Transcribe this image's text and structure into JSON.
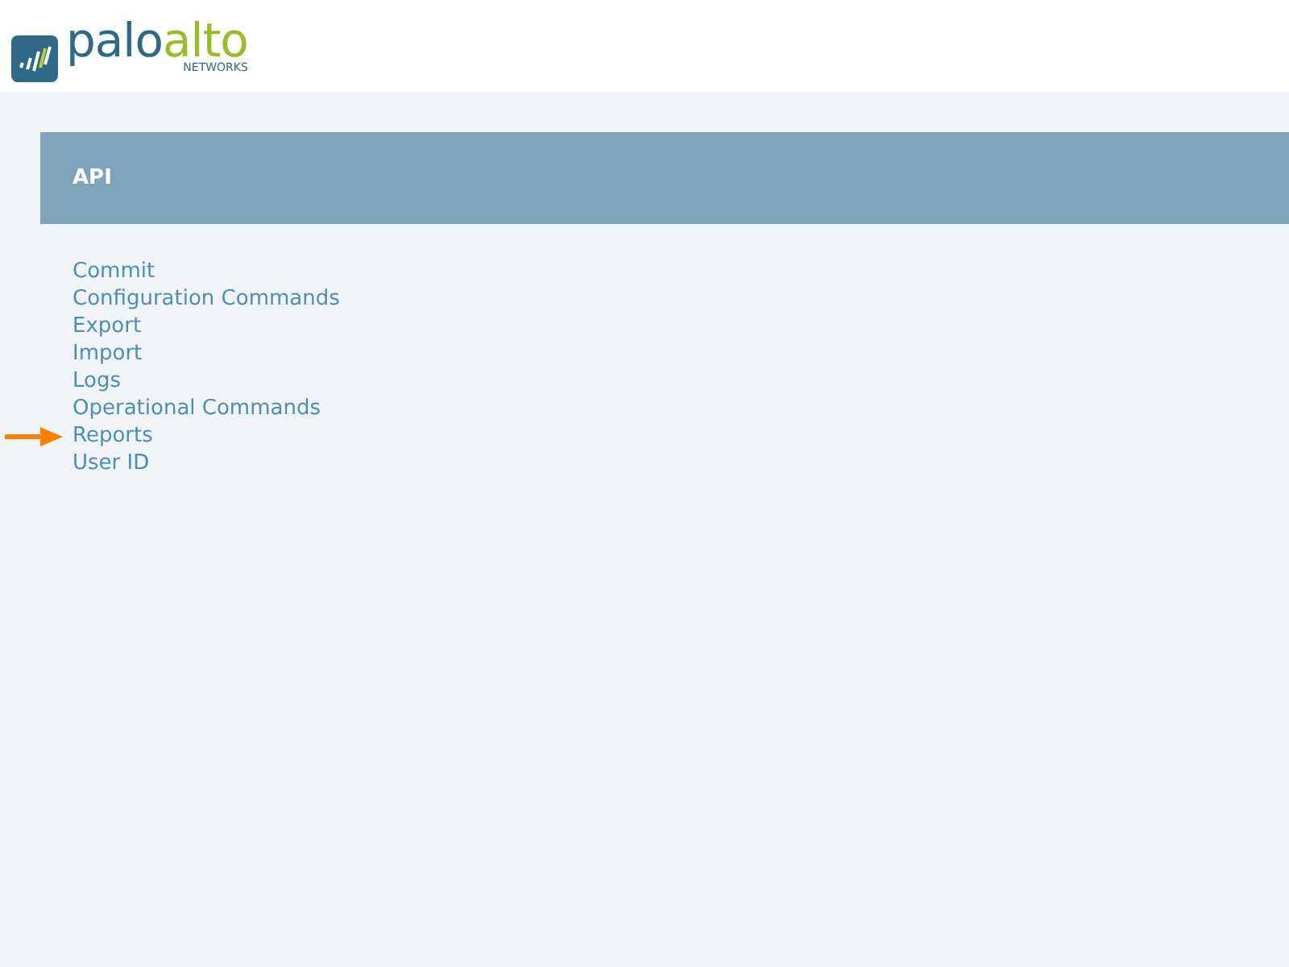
{
  "logo": {
    "word_1": "palo",
    "word_2": "alto",
    "tagline": "NETWORKS"
  },
  "panel": {
    "title": "API"
  },
  "links": [
    {
      "label": "Commit",
      "marked": false
    },
    {
      "label": "Configuration Commands",
      "marked": false
    },
    {
      "label": "Export",
      "marked": false
    },
    {
      "label": "Import",
      "marked": false
    },
    {
      "label": "Logs",
      "marked": false
    },
    {
      "label": "Operational Commands",
      "marked": false
    },
    {
      "label": "Reports",
      "marked": true
    },
    {
      "label": "User ID",
      "marked": false
    }
  ]
}
